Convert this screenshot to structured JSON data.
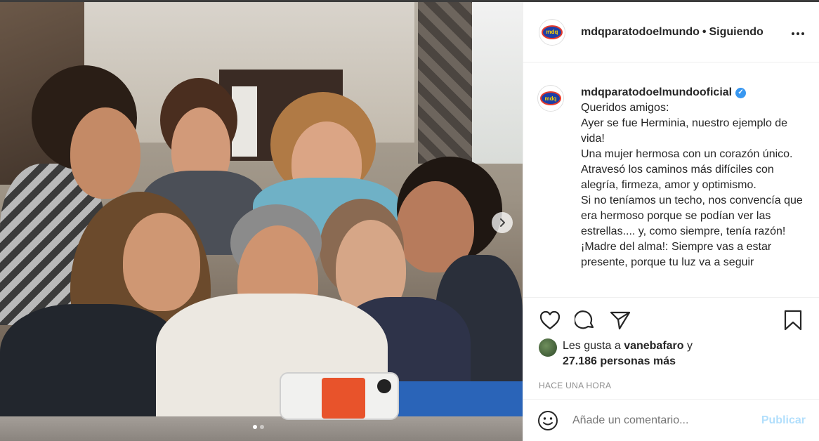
{
  "post": {
    "header": {
      "username": "mdqparatodoelmundo",
      "separator": "•",
      "follow_status": "Siguiendo",
      "more_icon": "more-horizontal-icon",
      "logo_text": "mdq"
    },
    "caption": {
      "username": "mdqparatodoelmundooficial",
      "verified_icon": "verified-badge-icon",
      "text": "Queridos amigos:\nAyer se fue Herminia, nuestro ejemplo de vida!\nUna mujer hermosa con un corazón único.\nAtravesó los caminos más difíciles con alegría, firmeza, amor y optimismo.\nSi no teníamos un techo, nos convencía que era hermoso porque se podían ver las estrellas.... y, como siempre, tenía razón!\n¡Madre del alma!: Siempre vas a estar presente, porque tu luz va a seguir"
    },
    "carousel": {
      "next_icon": "chevron-right-icon",
      "dots_total": 2,
      "active_dot": 0
    },
    "actions": {
      "like_icon": "heart-icon",
      "comment_icon": "comment-icon",
      "share_icon": "send-icon",
      "save_icon": "bookmark-icon"
    },
    "likes": {
      "prefix": "Les gusta a",
      "user": "vanebafaro",
      "connector": "y",
      "count_text": "27.186 personas más"
    },
    "timestamp": "HACE UNA HORA",
    "comment": {
      "emoji_icon": "smiley-icon",
      "placeholder": "Añade un comentario...",
      "post_label": "Publicar"
    }
  },
  "colors": {
    "accent": "#3897f0",
    "post_disabled": "#b2dffc",
    "muted": "#8e8e8e"
  }
}
